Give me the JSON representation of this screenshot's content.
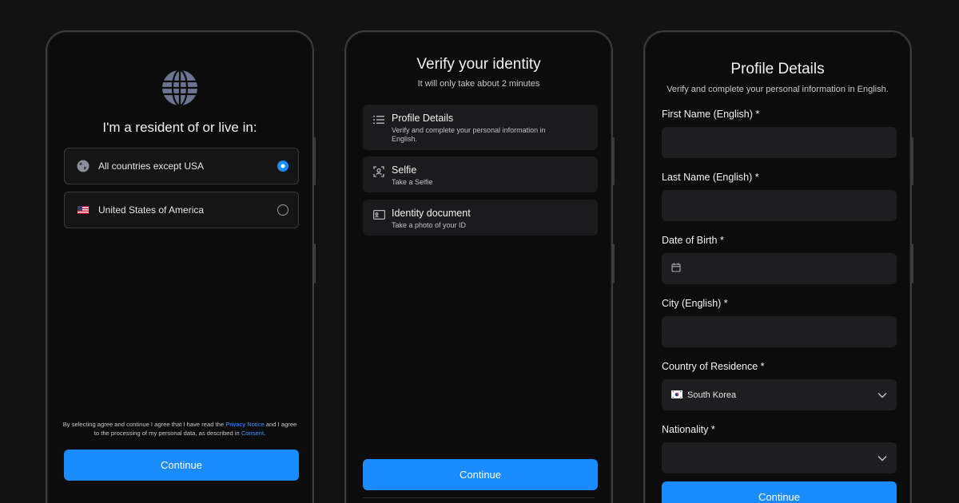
{
  "residence_screen": {
    "title": "I'm a resident of or live in:",
    "options": [
      {
        "label": "All countries except USA",
        "icon": "globe-icon",
        "selected": true
      },
      {
        "label": "United States of America",
        "icon": "us-flag-icon",
        "selected": false
      }
    ],
    "consent": {
      "text_1": "By selecting agree and continue I agree that I have read the ",
      "privacy_link": "Privacy Notice",
      "text_2": " and I agree to the processing of my personal data, as described in ",
      "consent_link": "Consent",
      "text_3": "."
    },
    "continue_label": "Continue"
  },
  "verify_screen": {
    "title": "Verify your identity",
    "subtitle": "It will only take about 2 minutes",
    "steps": [
      {
        "title": "Profile Details",
        "description": "Verify and complete your personal information in English.",
        "icon": "list-icon"
      },
      {
        "title": "Selfie",
        "description": "Take a Selfie",
        "icon": "face-scan-icon"
      },
      {
        "title": "Identity document",
        "description": "Take a photo of your ID",
        "icon": "id-card-icon"
      }
    ],
    "continue_label": "Continue"
  },
  "profile_screen": {
    "title": "Profile Details",
    "subtitle": "Verify and complete your personal information in English.",
    "fields": {
      "first_name": {
        "label": "First Name (English) *",
        "value": ""
      },
      "last_name": {
        "label": "Last Name (English) *",
        "value": ""
      },
      "dob": {
        "label": "Date of Birth *",
        "value": "",
        "icon": "calendar-icon"
      },
      "city": {
        "label": "City (English) *",
        "value": ""
      },
      "country": {
        "label": "Country of Residence *",
        "value": "South Korea",
        "icon": "kr-flag-icon"
      },
      "nationality": {
        "label": "Nationality *",
        "value": ""
      }
    },
    "continue_label": "Continue"
  },
  "colors": {
    "accent": "#1a8cff",
    "background": "#121212",
    "phone_bg": "#0c0c0d",
    "field_bg": "#1e1e20"
  }
}
